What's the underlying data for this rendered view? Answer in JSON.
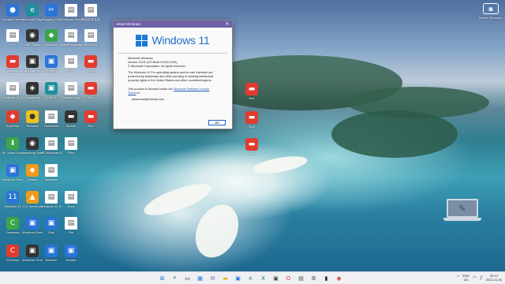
{
  "desktop": {
    "icons": [
      {
        "label": "Google Chrome",
        "glyph": "●",
        "style": "g-blue",
        "col": 0,
        "row": 0
      },
      {
        "label": "Microsoft Edge",
        "glyph": "e",
        "style": "g-teal",
        "col": 1,
        "row": 0
      },
      {
        "label": "Snipping Tool",
        "glyph": "✂",
        "style": "g-blue",
        "col": 2,
        "row": 0
      },
      {
        "label": "Windows Terminal",
        "glyph": "▤",
        "style": "g-doc",
        "col": 3,
        "row": 0
      },
      {
        "label": "新建文本文档",
        "glyph": "▤",
        "style": "g-doc",
        "col": 4,
        "row": 0
      },
      {
        "label": "PDF",
        "glyph": "▤",
        "style": "g-doc",
        "col": 0,
        "row": 1
      },
      {
        "label": "OBS Studio",
        "glyph": "◉",
        "style": "g-dark",
        "col": 1,
        "row": 1
      },
      {
        "label": "GeForce",
        "glyph": "◆",
        "style": "g-green",
        "col": 2,
        "row": 1
      },
      {
        "label": "Install Software",
        "glyph": "▤",
        "style": "g-doc",
        "col": 3,
        "row": 1
      },
      {
        "label": "README",
        "glyph": "▤",
        "style": "g-doc",
        "col": 4,
        "row": 1
      },
      {
        "label": "download",
        "glyph": "▬",
        "style": "g-red",
        "col": 0,
        "row": 2
      },
      {
        "label": "Hard Disk Sentinel",
        "glyph": "▣",
        "style": "g-dark",
        "col": 1,
        "row": 2
      },
      {
        "label": "TV Server",
        "glyph": "▣",
        "style": "g-blue",
        "col": 2,
        "row": 2
      },
      {
        "label": "PDF",
        "glyph": "▤",
        "style": "g-doc",
        "col": 3,
        "row": 2
      },
      {
        "label": "Video",
        "glyph": "▬",
        "style": "g-red",
        "col": 4,
        "row": 2
      },
      {
        "label": "Windows 11 22H2 Upgrade",
        "glyph": "▤",
        "style": "g-doc",
        "col": 0,
        "row": 3
      },
      {
        "label": "CrystalDisk",
        "glyph": "◈",
        "style": "g-dark",
        "col": 1,
        "row": 3
      },
      {
        "label": "CPU-Z",
        "glyph": "▣",
        "style": "g-teal",
        "col": 2,
        "row": 3
      },
      {
        "label": "Search Help",
        "glyph": "▤",
        "style": "g-doc",
        "col": 3,
        "row": 3
      },
      {
        "label": "Rec",
        "glyph": "▬",
        "style": "g-red",
        "col": 4,
        "row": 3
      },
      {
        "label": "AnyDesk",
        "glyph": "◆",
        "style": "g-red",
        "col": 0,
        "row": 4
      },
      {
        "label": "Persona",
        "glyph": "●",
        "style": "g-yellow",
        "col": 1,
        "row": 4
      },
      {
        "label": "Document",
        "glyph": "▤",
        "style": "g-doc",
        "col": 2,
        "row": 4
      },
      {
        "label": "Screen",
        "glyph": "▬",
        "style": "g-dark",
        "col": 3,
        "row": 4
      },
      {
        "label": "Rec",
        "glyph": "▬",
        "style": "g-red",
        "col": 4,
        "row": 4
      },
      {
        "label": "4K Video Downloader",
        "glyph": "⬇",
        "style": "g-green",
        "col": 0,
        "row": 5
      },
      {
        "label": "Samsung Studio",
        "glyph": "◉",
        "style": "g-dark",
        "col": 1,
        "row": 5
      },
      {
        "label": "PC Windows Apps",
        "glyph": "▤",
        "style": "g-doc",
        "col": 2,
        "row": 5
      },
      {
        "label": "Files",
        "glyph": "▤",
        "style": "g-doc",
        "col": 3,
        "row": 5
      },
      {
        "label": "Windows Setup",
        "glyph": "▣",
        "style": "g-blue",
        "col": 0,
        "row": 6
      },
      {
        "label": "Cleaner",
        "glyph": "◆",
        "style": "g-orange",
        "col": 1,
        "row": 6
      },
      {
        "label": "Windows",
        "glyph": "▤",
        "style": "g-doc",
        "col": 2,
        "row": 6
      },
      {
        "label": "Windows 11",
        "glyph": "11",
        "style": "g-blue",
        "col": 0,
        "row": 7
      },
      {
        "label": "VLC media player",
        "glyph": "▲",
        "style": "g-orange",
        "col": 1,
        "row": 7
      },
      {
        "label": "Windows 11 (Wallp)",
        "glyph": "▤",
        "style": "g-doc",
        "col": 2,
        "row": 7
      },
      {
        "label": "Docs",
        "glyph": "▤",
        "style": "g-doc",
        "col": 3,
        "row": 7
      },
      {
        "label": "Camtasia",
        "glyph": "C",
        "style": "g-green",
        "col": 0,
        "row": 8
      },
      {
        "label": "Windows Defender",
        "glyph": "▣",
        "style": "g-blue",
        "col": 1,
        "row": 8
      },
      {
        "label": "Disk",
        "glyph": "▣",
        "style": "g-blue",
        "col": 2,
        "row": 8
      },
      {
        "label": "File",
        "glyph": "▤",
        "style": "g-doc",
        "col": 3,
        "row": 8
      },
      {
        "label": "CCleaner",
        "glyph": "C",
        "style": "g-red",
        "col": 0,
        "row": 9
      },
      {
        "label": "Windows Terminal",
        "glyph": "▣",
        "style": "g-dark",
        "col": 1,
        "row": 9
      },
      {
        "label": "Network",
        "glyph": "▣",
        "style": "g-blue",
        "col": 2,
        "row": 9
      },
      {
        "label": "Monitor",
        "glyph": "▣",
        "style": "g-blue",
        "col": 3,
        "row": 9
      }
    ],
    "right_icons": [
      {
        "label": "Rec",
        "glyph": "▬",
        "style": "g-red"
      },
      {
        "label": "Rec",
        "glyph": "▬",
        "style": "g-red"
      },
      {
        "label": "Rec",
        "glyph": "▬",
        "style": "g-red"
      }
    ],
    "camera_label": "Screen Recorder"
  },
  "about": {
    "title": "About Windows",
    "close": "✕",
    "logo_text": "Windows 11",
    "line1": "Microsoft Windows",
    "line2": "Version 21H2 (OS Build 22000.1219)",
    "line3": "© Microsoft Corporation. All rights reserved.",
    "para": "The Windows 11 Pro operating system and its user interface are protected by trademark and other pending or existing intellectual property rights in the United States and other countries/regions.",
    "license_prefix": "This product is licensed under the ",
    "license_link": "Microsoft Software License Terms",
    "license_suffix": " to:",
    "email": "amancote@hotmail.com",
    "ok": "OK"
  },
  "taskbar": {
    "icons": [
      {
        "name": "start-icon",
        "glyph": "⊞",
        "color": "#1e7ad6"
      },
      {
        "name": "search-icon",
        "glyph": "⌕",
        "color": "#222222"
      },
      {
        "name": "task-view-icon",
        "glyph": "▭",
        "color": "#222222"
      },
      {
        "name": "widgets-icon",
        "glyph": "▦",
        "color": "#1e7ad6"
      },
      {
        "name": "chat-icon",
        "glyph": "✉",
        "color": "#6f60a8"
      },
      {
        "name": "file-explorer-icon",
        "glyph": "▬",
        "color": "#e9b51c"
      },
      {
        "name": "store-icon",
        "glyph": "▣",
        "color": "#1e7ad6"
      },
      {
        "name": "edge-icon",
        "glyph": "e",
        "color": "#1f8f9a"
      },
      {
        "name": "excel-icon",
        "glyph": "X",
        "color": "#1f7a44"
      },
      {
        "name": "app-icon",
        "glyph": "▣",
        "color": "#444444"
      },
      {
        "name": "office-icon",
        "glyph": "O",
        "color": "#d6402a"
      },
      {
        "name": "notes-icon",
        "glyph": "▤",
        "color": "#444444"
      },
      {
        "name": "settings-icon",
        "glyph": "⚙",
        "color": "#444444"
      },
      {
        "name": "terminal-icon",
        "glyph": "▮",
        "color": "#222222"
      },
      {
        "name": "recorder-icon",
        "glyph": "◉",
        "color": "#d6402a"
      }
    ],
    "lang_top": "ENG",
    "lang_bottom": "US",
    "time": "20:13",
    "date": "2022-11-30"
  }
}
